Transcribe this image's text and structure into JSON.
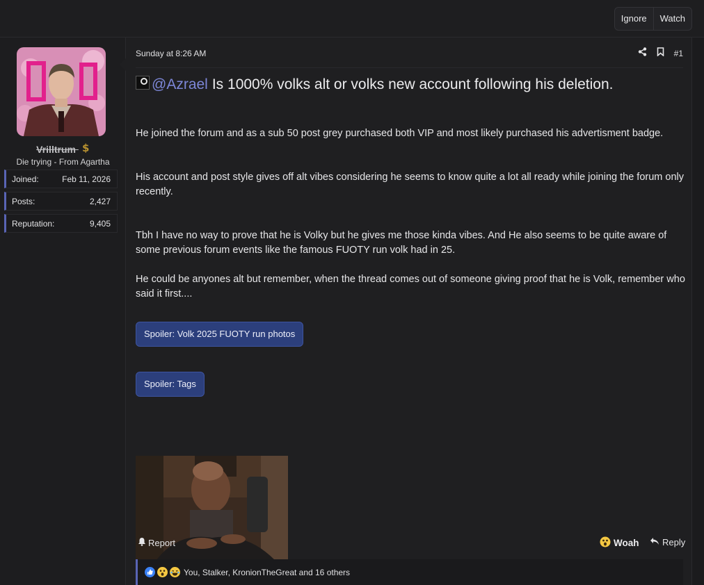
{
  "top_actions": {
    "ignore": "Ignore",
    "watch": "Watch"
  },
  "user": {
    "name": "Vrilltrum",
    "title": "Die trying - From Agartha",
    "stats": [
      {
        "label": "Joined:",
        "value": "Feb 11, 2026"
      },
      {
        "label": "Posts:",
        "value": "2,427"
      },
      {
        "label": "Reputation:",
        "value": "9,405"
      }
    ]
  },
  "post": {
    "date": "Sunday at 8:26 AM",
    "number": "#1",
    "mention": "@Azrael",
    "headline": "Is 1000% volks alt or volks new account following his deletion.",
    "paragraphs": [
      "He joined the forum and as a sub 50 post grey purchased both VIP and most likely purchased his advertisment badge.",
      "His account and post style gives off alt vibes considering he seems to know quite a lot all ready while joining the forum only recently.",
      "Tbh I have no way to prove that he is Volky but he gives me those kinda vibes. And He also seems to be quite aware of some previous forum events like the famous FUOTY run volk had in 25.",
      "He could be anyones alt but remember, when the thread comes out of someone giving proof that he is Volk, remember who said it first...."
    ],
    "spoilers": [
      "Spoiler: Volk 2025 FUOTY run photos",
      "Spoiler: Tags"
    ]
  },
  "actions": {
    "report": "Report",
    "woah": "Woah",
    "reply": "Reply"
  },
  "reactions": {
    "text": "You, Stalker, KronionTheGreat and 16 others"
  },
  "colors": {
    "accent": "#5964b5",
    "mention": "#7d87d8",
    "spoiler_bg": "#2c3f7c"
  }
}
